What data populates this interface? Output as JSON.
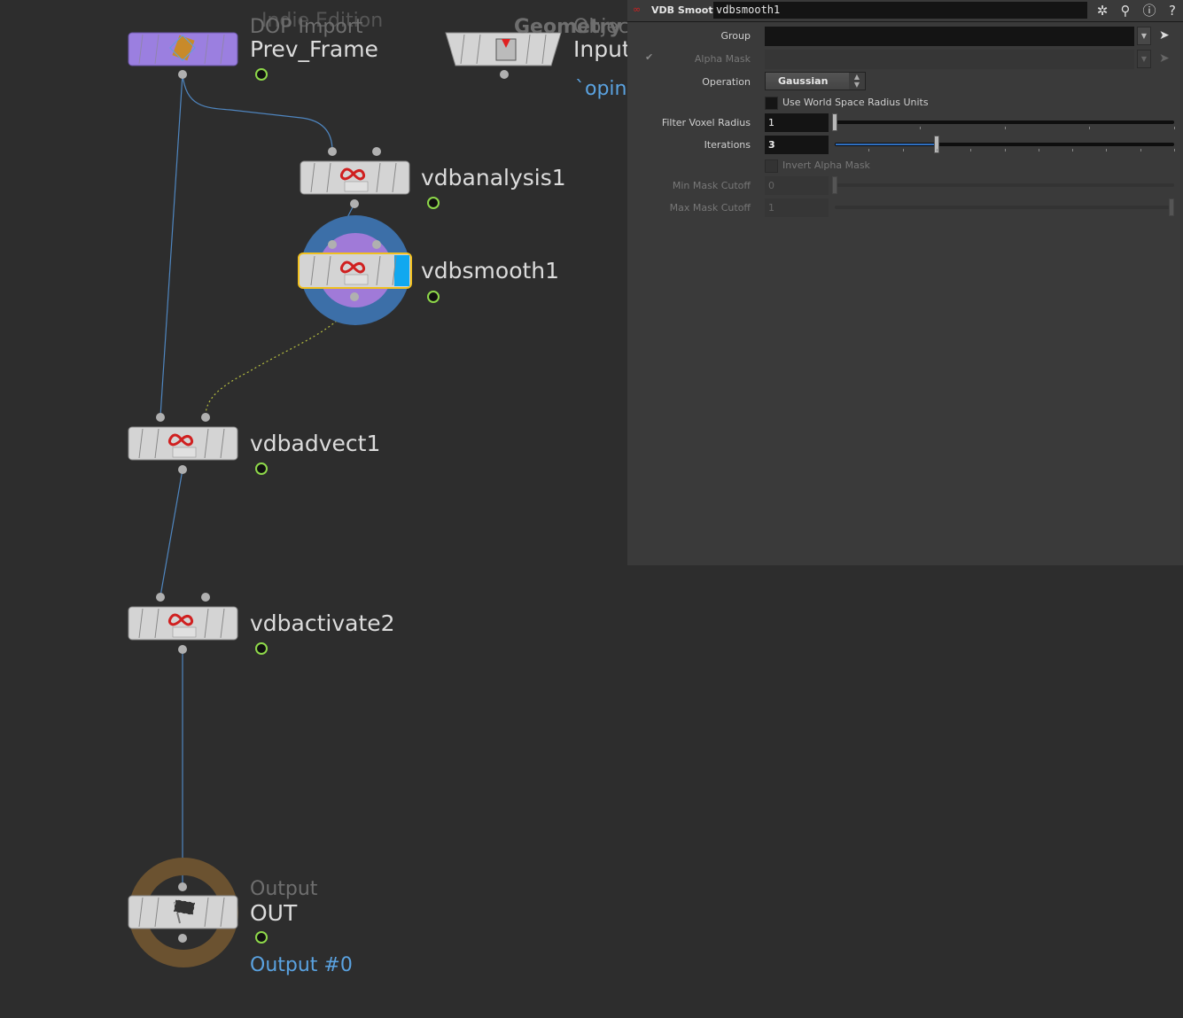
{
  "network": {
    "watermark": "Indie Edition",
    "nodes": [
      {
        "type": "DOP Import",
        "name": "Prev_Frame",
        "color": "#9b7fe0"
      },
      {
        "type": "Geometry",
        "type_overlap": "Object",
        "name": "Input",
        "extra": "`opin"
      },
      {
        "name": "vdbanalysis1"
      },
      {
        "name": "vdbsmooth1",
        "selected": true
      },
      {
        "name": "vdbadvect1"
      },
      {
        "name": "vdbactivate2"
      },
      {
        "type": "Output",
        "name": "OUT",
        "extra": "Output #0"
      }
    ],
    "icon_text": "VDB"
  },
  "panel": {
    "node_type": "VDB Smooth",
    "node_name": "vdbsmooth1",
    "icons": [
      "gear-icon",
      "search-icon",
      "info-icon",
      "help-icon"
    ],
    "params": {
      "group": {
        "label": "Group",
        "value": ""
      },
      "alpha_mask": {
        "label": "Alpha Mask",
        "value": "",
        "enabled": false
      },
      "operation": {
        "label": "Operation",
        "value": "Gaussian"
      },
      "world_space": {
        "label": "Use World Space Radius Units",
        "checked": false
      },
      "filter_voxel_radius": {
        "label": "Filter Voxel Radius",
        "value": "1"
      },
      "iterations": {
        "label": "Iterations",
        "value": "3",
        "slider_fraction": 0.3
      },
      "invert_alpha": {
        "label": "Invert Alpha Mask",
        "checked": false,
        "enabled": false
      },
      "min_mask_cutoff": {
        "label": "Min Mask Cutoff",
        "value": "0",
        "enabled": false
      },
      "max_mask_cutoff": {
        "label": "Max Mask Cutoff",
        "value": "1",
        "enabled": false
      }
    }
  }
}
